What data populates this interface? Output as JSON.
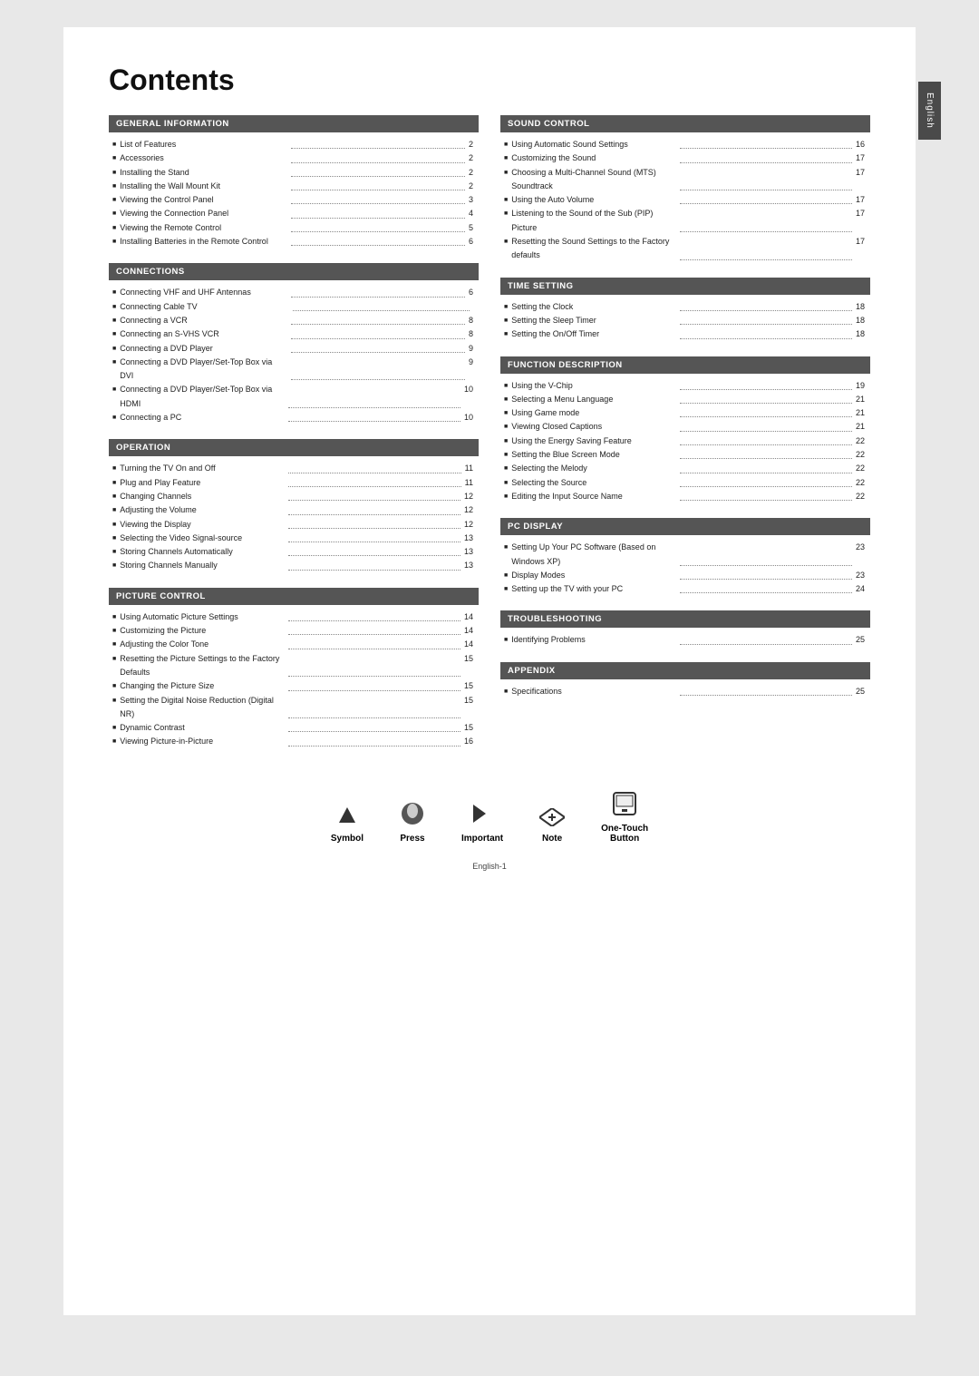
{
  "page": {
    "title": "Contents",
    "side_tab": "English",
    "footer": "English-1"
  },
  "sections": {
    "left": [
      {
        "id": "general-information",
        "header": "GENERAL INFORMATION",
        "items": [
          {
            "label": "List of Features",
            "page": "2"
          },
          {
            "label": "Accessories",
            "page": "2"
          },
          {
            "label": "Installing the Stand",
            "page": "2"
          },
          {
            "label": "Installing the Wall Mount Kit",
            "page": "2"
          },
          {
            "label": "Viewing the Control Panel",
            "page": "3"
          },
          {
            "label": "Viewing the Connection Panel",
            "page": "4"
          },
          {
            "label": "Viewing the Remote Control",
            "page": "5"
          },
          {
            "label": "Installing Batteries in the Remote Control",
            "page": "6"
          }
        ]
      },
      {
        "id": "connections",
        "header": "CONNECTIONS",
        "items": [
          {
            "label": "Connecting VHF and UHF Antennas",
            "page": "6"
          },
          {
            "label": "Connecting Cable TV",
            "page": ""
          },
          {
            "label": "Connecting a VCR",
            "page": "8"
          },
          {
            "label": "Connecting an S-VHS VCR",
            "page": "8"
          },
          {
            "label": "Connecting a DVD Player",
            "page": "9"
          },
          {
            "label": "Connecting a DVD Player/Set-Top Box via DVI",
            "page": "9"
          },
          {
            "label": "Connecting a DVD Player/Set-Top Box via HDMI",
            "page": "10"
          },
          {
            "label": "Connecting a PC",
            "page": "10"
          }
        ]
      },
      {
        "id": "operation",
        "header": "OPERATION",
        "items": [
          {
            "label": "Turning the TV On and Off",
            "page": "11"
          },
          {
            "label": "Plug and Play Feature",
            "page": "11"
          },
          {
            "label": "Changing Channels",
            "page": "12"
          },
          {
            "label": "Adjusting the Volume",
            "page": "12"
          },
          {
            "label": "Viewing the Display",
            "page": "12"
          },
          {
            "label": "Selecting the Video Signal-source",
            "page": "13"
          },
          {
            "label": "Storing Channels Automatically",
            "page": "13"
          },
          {
            "label": "Storing Channels Manually",
            "page": "13"
          }
        ]
      },
      {
        "id": "picture-control",
        "header": "PICTURE CONTROL",
        "items": [
          {
            "label": "Using Automatic Picture Settings",
            "page": "14"
          },
          {
            "label": "Customizing the Picture",
            "page": "14"
          },
          {
            "label": "Adjusting the Color Tone",
            "page": "14"
          },
          {
            "label": "Resetting the Picture Settings to the Factory Defaults",
            "page": "15"
          },
          {
            "label": "Changing the Picture Size",
            "page": "15"
          },
          {
            "label": "Setting the Digital Noise Reduction (Digital NR)",
            "page": "15"
          },
          {
            "label": "Dynamic Contrast",
            "page": "15"
          },
          {
            "label": "Viewing Picture-in-Picture",
            "page": "16"
          }
        ]
      }
    ],
    "right": [
      {
        "id": "sound-control",
        "header": "SOUND CONTROL",
        "items": [
          {
            "label": "Using Automatic Sound Settings",
            "page": "16"
          },
          {
            "label": "Customizing the Sound",
            "page": "17"
          },
          {
            "label": "Choosing a Multi-Channel Sound (MTS) Soundtrack",
            "page": "17"
          },
          {
            "label": "Using the Auto Volume",
            "page": "17"
          },
          {
            "label": "Listening to the Sound of the Sub (PIP) Picture",
            "page": "17"
          },
          {
            "label": "Resetting the Sound Settings to the Factory defaults",
            "page": "17"
          }
        ]
      },
      {
        "id": "time-setting",
        "header": "TIME SETTING",
        "items": [
          {
            "label": "Setting the Clock",
            "page": "18"
          },
          {
            "label": "Setting the Sleep Timer",
            "page": "18"
          },
          {
            "label": "Setting the On/Off Timer",
            "page": "18"
          }
        ]
      },
      {
        "id": "function-description",
        "header": "FUNCTION DESCRIPTION",
        "items": [
          {
            "label": "Using the V-Chip",
            "page": "19"
          },
          {
            "label": "Selecting a Menu Language",
            "page": "21"
          },
          {
            "label": "Using Game mode",
            "page": "21"
          },
          {
            "label": "Viewing Closed Captions",
            "page": "21"
          },
          {
            "label": "Using the Energy Saving Feature",
            "page": "22"
          },
          {
            "label": "Setting the Blue Screen Mode",
            "page": "22"
          },
          {
            "label": "Selecting the Melody",
            "page": "22"
          },
          {
            "label": "Selecting the Source",
            "page": "22"
          },
          {
            "label": "Editing the Input Source Name",
            "page": "22"
          }
        ]
      },
      {
        "id": "pc-display",
        "header": "PC DISPLAY",
        "items": [
          {
            "label": "Setting Up Your PC Software (Based on Windows XP)",
            "page": "23"
          },
          {
            "label": "Display Modes",
            "page": "23"
          },
          {
            "label": "Setting up the TV with your PC",
            "page": "24"
          }
        ]
      },
      {
        "id": "troubleshooting",
        "header": "TROUBLESHOOTING",
        "items": [
          {
            "label": "Identifying Problems",
            "page": "25"
          }
        ]
      },
      {
        "id": "appendix",
        "header": "APPENDIX",
        "items": [
          {
            "label": "Specifications",
            "page": "25"
          }
        ]
      }
    ]
  },
  "legend": {
    "items": [
      {
        "id": "symbol",
        "icon": "▲",
        "label": "Symbol"
      },
      {
        "id": "press",
        "icon": "👆",
        "label": "Press"
      },
      {
        "id": "important",
        "icon": "✎",
        "label": "Important"
      },
      {
        "id": "note",
        "icon": "➤",
        "label": "Note"
      },
      {
        "id": "one-touch",
        "icon": "📺",
        "label": "One-Touch\nButton"
      }
    ]
  }
}
